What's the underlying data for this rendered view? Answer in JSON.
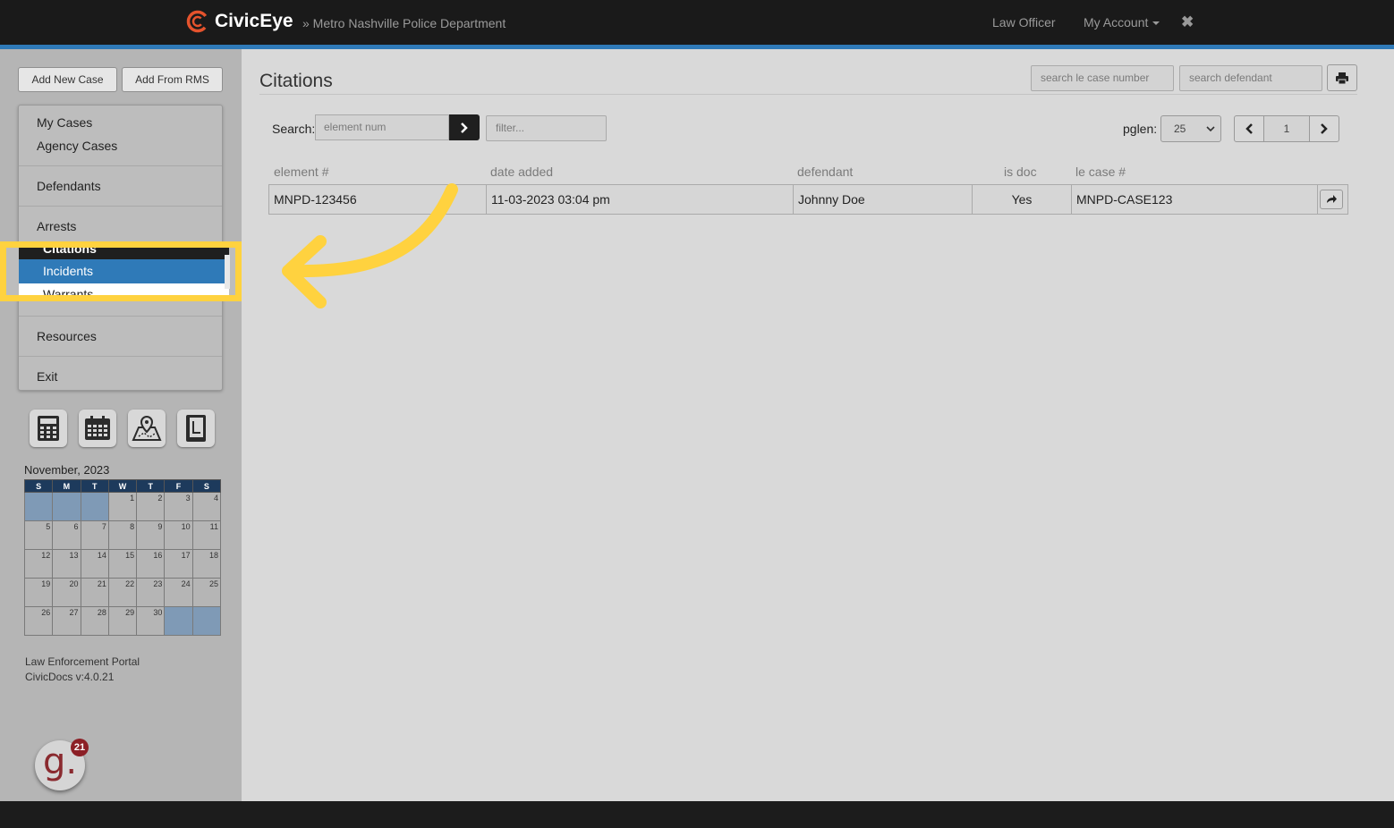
{
  "header": {
    "brand": "CivicEye",
    "department": "» Metro Nashville Police Department",
    "role": "Law Officer",
    "account": "My Account",
    "close_glyph": "✖"
  },
  "sidebar": {
    "buttons": {
      "add_new_case": "Add New Case",
      "add_from_rms": "Add From RMS"
    },
    "menu": {
      "my_cases": "My Cases",
      "agency_cases": "Agency Cases",
      "defendants": "Defendants",
      "arrests": "Arrests",
      "citations": "Citations",
      "incidents": "Incidents",
      "warrants": "Warrants",
      "resources": "Resources",
      "exit": "Exit"
    },
    "tools": [
      "calculator-icon",
      "calendar-icon",
      "map-icon",
      "notebook-icon"
    ],
    "calendar": {
      "title": "November, 2023",
      "weekdays": [
        "S",
        "M",
        "T",
        "W",
        "T",
        "F",
        "S"
      ],
      "weeks": [
        [
          "",
          "",
          "",
          "1",
          "2",
          "3",
          "4"
        ],
        [
          "5",
          "6",
          "7",
          "8",
          "9",
          "10",
          "11"
        ],
        [
          "12",
          "13",
          "14",
          "15",
          "16",
          "17",
          "18"
        ],
        [
          "19",
          "20",
          "21",
          "22",
          "23",
          "24",
          "25"
        ],
        [
          "26",
          "27",
          "28",
          "29",
          "30",
          "",
          ""
        ]
      ]
    },
    "footer": {
      "line1": "Law Enforcement Portal",
      "line2": "CivicDocs v:4.0.21"
    },
    "badge": {
      "letter": "g.",
      "count": "21"
    }
  },
  "main": {
    "title": "Citations",
    "search_case_placeholder": "search le case number",
    "search_defendant_placeholder": "search defendant",
    "search_label": "Search:",
    "element_placeholder": "element num",
    "filter_placeholder": "filter...",
    "pglen_label": "pglen:",
    "pglen_value": "25",
    "page_number": "1",
    "columns": [
      "element #",
      "date added",
      "defendant",
      "is doc",
      "le case #"
    ],
    "rows": [
      {
        "element": "MNPD-123456",
        "date_added": "11-03-2023 03:04 pm",
        "defendant": "Johnny Doe",
        "is_doc": "Yes",
        "le_case": "MNPD-CASE123"
      }
    ]
  },
  "colors": {
    "highlight": "#ffd23f",
    "accent": "#2f7ab8",
    "calendar_header": "#1d3a5c"
  }
}
